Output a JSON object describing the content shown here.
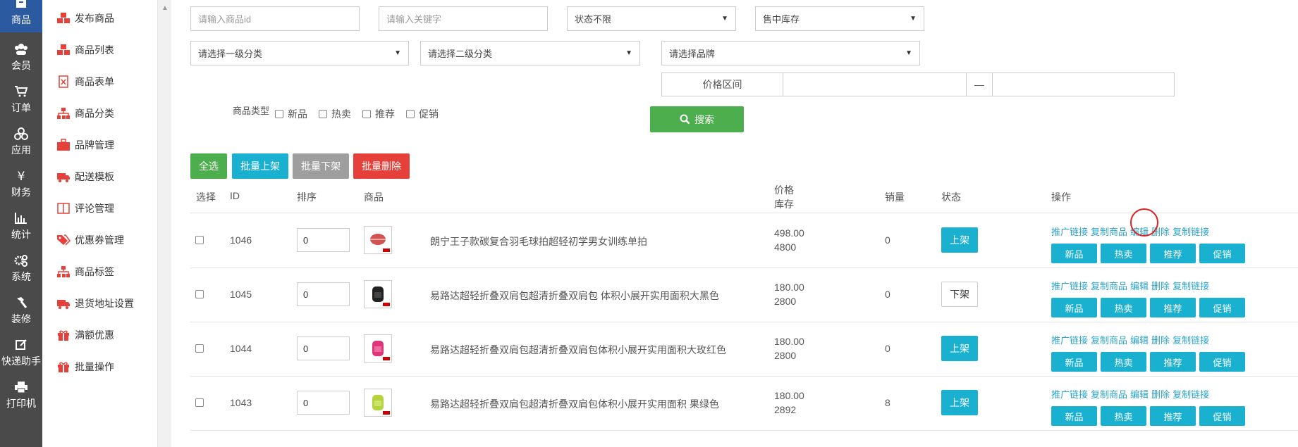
{
  "rail": [
    {
      "label": "商品",
      "icon": "box-icon"
    },
    {
      "label": "会员",
      "icon": "users-icon"
    },
    {
      "label": "订单",
      "icon": "cart-icon"
    },
    {
      "label": "应用",
      "icon": "apps-icon"
    },
    {
      "label": "财务",
      "icon": "yen-icon"
    },
    {
      "label": "统计",
      "icon": "bar-chart-icon"
    },
    {
      "label": "系统",
      "icon": "cogs-icon"
    },
    {
      "label": "装修",
      "icon": "hammer-icon"
    },
    {
      "label": "快递助手",
      "icon": "edit-icon"
    },
    {
      "label": "打印机",
      "icon": "printer-icon"
    }
  ],
  "sidebar": [
    {
      "label": "发布商品",
      "icon": "cubes-icon"
    },
    {
      "label": "商品列表",
      "icon": "cubes-icon"
    },
    {
      "label": "商品表单",
      "icon": "excel-file-icon"
    },
    {
      "label": "商品分类",
      "icon": "sitemap-icon"
    },
    {
      "label": "品牌管理",
      "icon": "briefcase-icon"
    },
    {
      "label": "配送模板",
      "icon": "truck-icon"
    },
    {
      "label": "评论管理",
      "icon": "columns-icon"
    },
    {
      "label": "优惠券管理",
      "icon": "tags-icon"
    },
    {
      "label": "商品标签",
      "icon": "sitemap-icon"
    },
    {
      "label": "退货地址设置",
      "icon": "truck-icon"
    },
    {
      "label": "满额优惠",
      "icon": "gift-icon"
    },
    {
      "label": "批量操作",
      "icon": "gift-icon"
    }
  ],
  "filters": {
    "goods_id_placeholder": "请输入商品id",
    "keyword_placeholder": "请输入关键字",
    "status_select": "状态不限",
    "stock_select": "售中库存",
    "cat1_select": "请选择一级分类",
    "cat2_select": "请选择二级分类",
    "brand_select": "请选择品牌",
    "price_label": "价格区间",
    "price_dash": "—",
    "type_label": "商品类型",
    "types": [
      "新品",
      "热卖",
      "推荐",
      "促销"
    ],
    "search_label": "搜索"
  },
  "bulk": {
    "select_all": "全选",
    "batch_on": "批量上架",
    "batch_off": "批量下架",
    "batch_delete": "批量删除"
  },
  "table": {
    "headers": {
      "select": "选择",
      "id": "ID",
      "sort": "排序",
      "goods": "商品",
      "price": "价格",
      "stock": "库存",
      "sales": "销量",
      "status": "状态",
      "ops": "操作"
    },
    "links": [
      "推广链接",
      "复制商品",
      "编辑",
      "删除",
      "复制链接"
    ],
    "tags": [
      "新品",
      "热卖",
      "推荐",
      "促销"
    ],
    "rows": [
      {
        "id": "1046",
        "sort": "0",
        "name": "朗宁王子款碳复合羽毛球拍超轻初学男女训练单拍",
        "price": "498.00",
        "stock": "4800",
        "sales": "0",
        "status": "上架",
        "on": true
      },
      {
        "id": "1045",
        "sort": "0",
        "name": "易路达超轻折叠双肩包超清折叠双肩包 体积小展开实用面积大黑色",
        "price": "180.00",
        "stock": "2800",
        "sales": "0",
        "status": "下架",
        "on": false
      },
      {
        "id": "1044",
        "sort": "0",
        "name": "易路达超轻折叠双肩包超清折叠双肩包体积小展开实用面积大玫红色",
        "price": "180.00",
        "stock": "2800",
        "sales": "0",
        "status": "上架",
        "on": true
      },
      {
        "id": "1043",
        "sort": "0",
        "name": "易路达超轻折叠双肩包超清折叠双肩包体积小展开实用面积 果绿色",
        "price": "180.00",
        "stock": "2892",
        "sales": "8",
        "status": "上架",
        "on": true
      }
    ]
  },
  "colors": {
    "rail_bg": "#4a4a4a",
    "rail_active": "#2c5aa0",
    "green": "#4cae4c",
    "cyan": "#1ab0d0",
    "gray": "#9e9e9e",
    "red": "#e5413a",
    "link": "#2aa3c9"
  }
}
